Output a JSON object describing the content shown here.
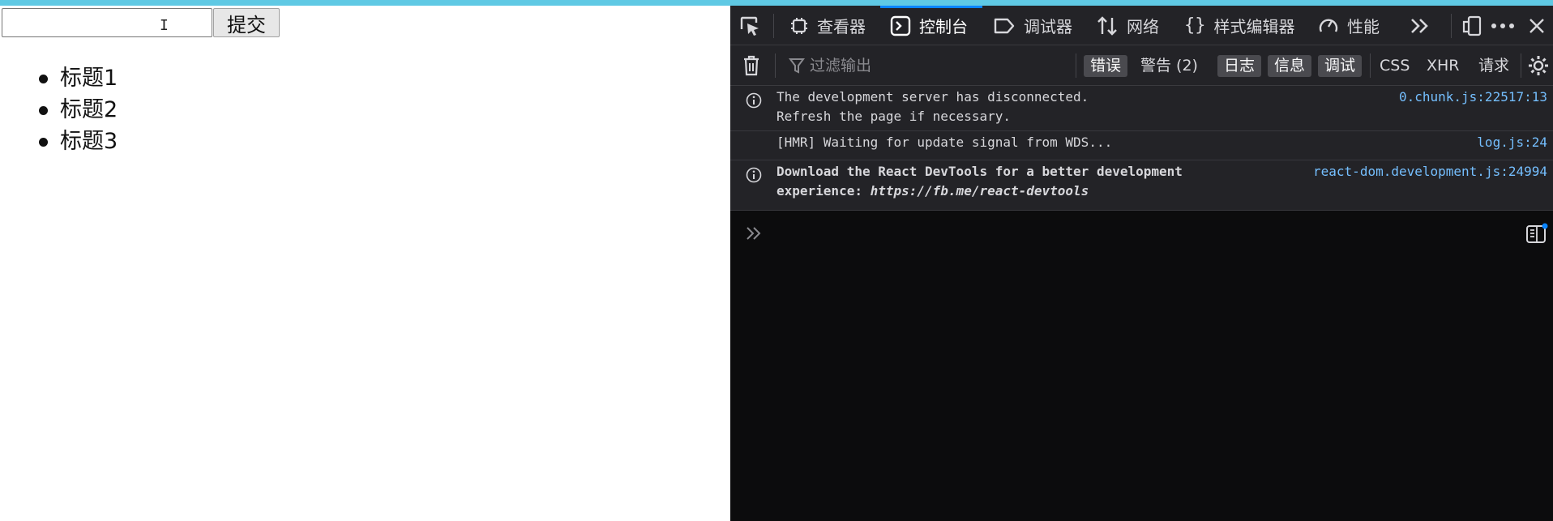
{
  "page": {
    "input_value": "",
    "submit_label": "提交",
    "titles": [
      "标题1",
      "标题2",
      "标题3"
    ]
  },
  "devtools": {
    "tabs": {
      "inspector": "查看器",
      "console": "控制台",
      "debugger": "调试器",
      "network": "网络",
      "style_editor": "样式编辑器",
      "performance": "性能"
    },
    "selected_tab": "console",
    "filter": {
      "placeholder": "过滤输出",
      "levels": {
        "errors": "错误",
        "warnings": "警告 (2)",
        "logs": "日志",
        "info": "信息",
        "debug": "调试"
      },
      "extra": {
        "css": "CSS",
        "xhr": "XHR",
        "requests": "请求"
      }
    },
    "messages": [
      {
        "line1": "The development server has disconnected.",
        "line2": "Refresh the page if necessary.",
        "source": "0.chunk.js:22517:13",
        "icon": "info-icon"
      },
      {
        "line1": "[HMR] Waiting for update signal from WDS...",
        "source": "log.js:24",
        "icon": ""
      },
      {
        "line1": "Download the React DevTools for a better development",
        "line2_prefix": "experience: ",
        "line2_link": "https://fb.me/react-devtools",
        "source": "react-dom.development.js:24994",
        "icon": "info-icon"
      }
    ],
    "colors": {
      "accent": "#0a84ff",
      "source_link": "#75bfff",
      "top_bar": "#5fc9e4"
    }
  }
}
